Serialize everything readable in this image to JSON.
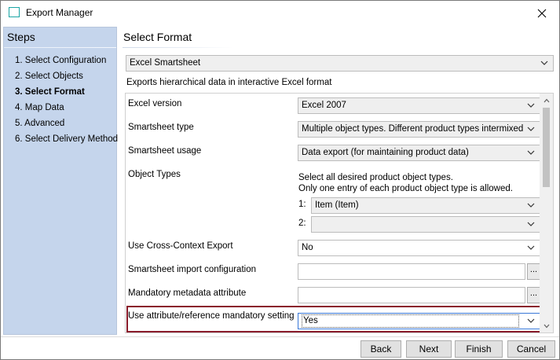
{
  "window": {
    "title": "Export Manager",
    "icon": "window-icon",
    "close_icon": "close-icon"
  },
  "sidebar": {
    "title": "Steps",
    "items": [
      {
        "label": "1. Select Configuration",
        "active": false
      },
      {
        "label": "2. Select Objects",
        "active": false
      },
      {
        "label": "3. Select Format",
        "active": true
      },
      {
        "label": "4. Map Data",
        "active": false
      },
      {
        "label": "5. Advanced",
        "active": false
      },
      {
        "label": "6. Select Delivery Method",
        "active": false
      }
    ]
  },
  "main": {
    "title": "Select Format",
    "format": "Excel Smartsheet",
    "description": "Exports hierarchical data in interactive Excel format",
    "fields": {
      "excel_version": {
        "label": "Excel version",
        "value": "Excel 2007"
      },
      "smartsheet_type": {
        "label": "Smartsheet type",
        "value": "Multiple object types. Different product types intermixed"
      },
      "smartsheet_usage": {
        "label": "Smartsheet usage",
        "value": "Data export (for maintaining product data)"
      },
      "object_types": {
        "label": "Object Types",
        "hint_line1": "Select all desired product object types.",
        "hint_line2": "Only one entry of each product object type is allowed.",
        "entries": [
          {
            "index": "1:",
            "value": "Item (Item)"
          },
          {
            "index": "2:",
            "value": ""
          }
        ]
      },
      "cross_context": {
        "label": "Use Cross-Context Export",
        "value": "No"
      },
      "import_config": {
        "label": "Smartsheet import configuration",
        "value": "",
        "button": "..."
      },
      "mandatory_metadata": {
        "label": "Mandatory metadata attribute",
        "value": "",
        "button": "..."
      },
      "mandatory_setting": {
        "label": "Use attribute/reference mandatory setting",
        "value": "Yes"
      }
    }
  },
  "footer": {
    "back": "Back",
    "next": "Next",
    "finish": "Finish",
    "cancel": "Cancel"
  },
  "colors": {
    "sidebar_bg": "#c5d5ec",
    "highlight_border": "#8a1c2b",
    "icon_accent": "#1aa5a5"
  }
}
